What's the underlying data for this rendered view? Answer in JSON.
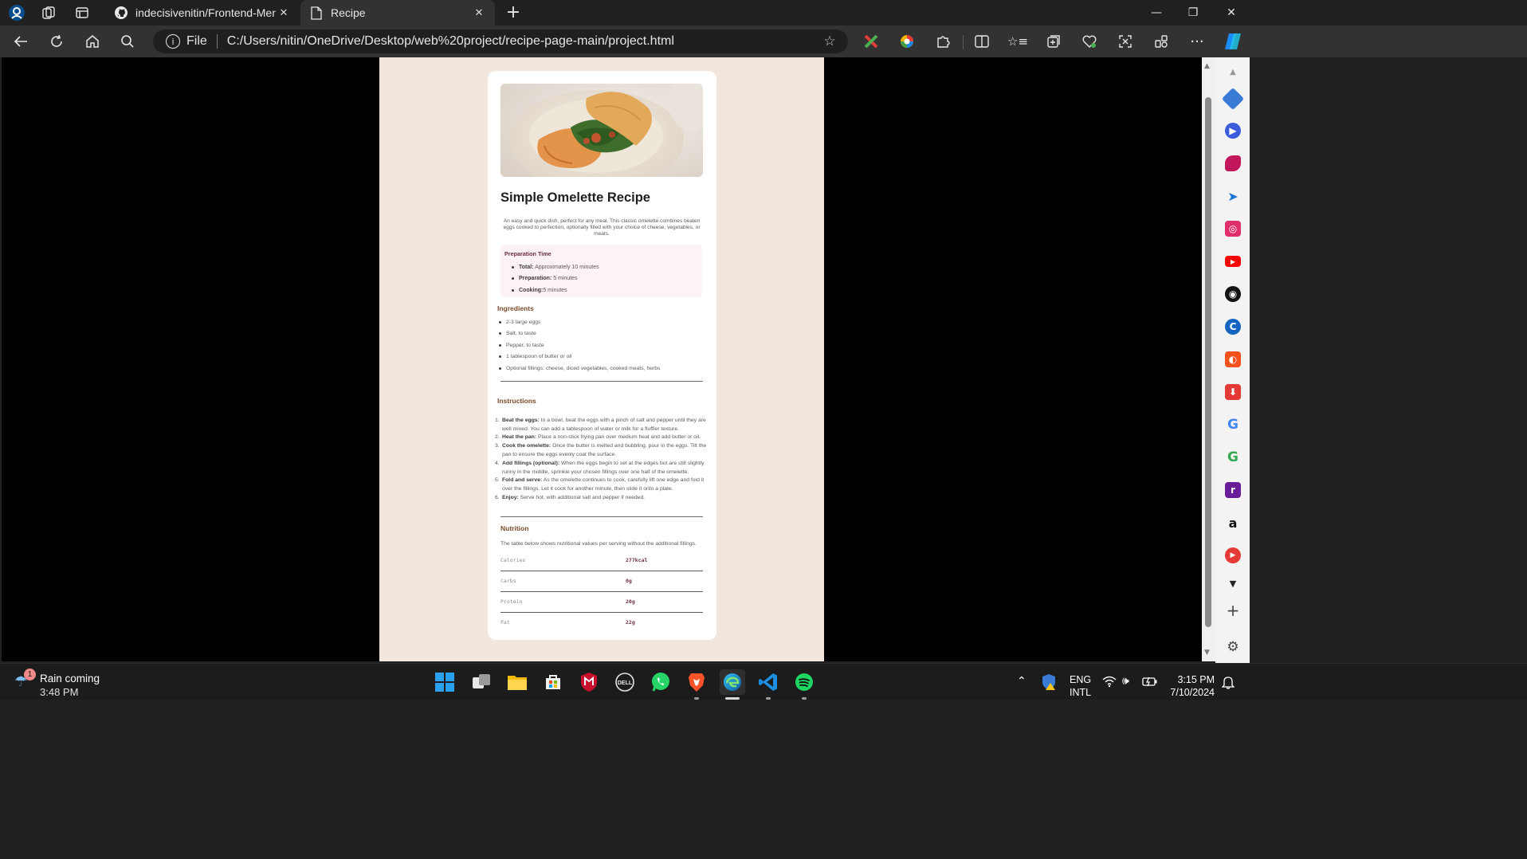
{
  "browser": {
    "tabs": [
      {
        "label": "indecisivenitin/Frontend-Mentor",
        "close": "✕"
      },
      {
        "label": "Recipe",
        "close": "✕"
      }
    ],
    "new_tab": "+",
    "window_controls": {
      "minimize": "—",
      "restore": "❐",
      "close": "✕"
    },
    "address": {
      "scheme_label": "File",
      "url": "C:/Users/nitin/OneDrive/Desktop/web%20project/recipe-page-main/project.html"
    }
  },
  "recipe": {
    "title": "Simple Omelette Recipe",
    "description": "An easy and quick dish, perfect for any meal. This classic omelette combines beaten eggs cooked to perfection, optionally filled with your choice of cheese, vegetables, or meats.",
    "preparation": {
      "title": "Preparation Time",
      "items": [
        {
          "label": "Total:",
          "value": "Approximately 10 minutes"
        },
        {
          "label": "Preparation:",
          "value": "5 minutes"
        },
        {
          "label": "Cooking:",
          "value": "5 minutes"
        }
      ]
    },
    "ingredients": {
      "title": "Ingredients",
      "items": [
        "2-3 large eggs",
        "Salt, to taste",
        "Pepper, to taste",
        "1 tablespoon of butter or oil",
        "Optional fillings: cheese, diced vegetables, cooked meats, herbs"
      ]
    },
    "instructions": {
      "title": "Instructions",
      "steps": [
        {
          "num": "1.",
          "label": "Beat the eggs:",
          "text": "In a bowl, beat the eggs with a pinch of salt and pepper until they are well mixed. You can add a tablespoon of water or milk for a fluffier texture."
        },
        {
          "num": "2.",
          "label": "Heat the pan:",
          "text": "Place a non-stick frying pan over medium heat and add butter or oil."
        },
        {
          "num": "3.",
          "label": "Cook the omelette:",
          "text": "Once the butter is melted and bubbling, pour in the eggs. Tilt the pan to ensure the eggs evenly coat the surface."
        },
        {
          "num": "4.",
          "label": "Add fillings (optional):",
          "text": "When the eggs begin to set at the edges but are still slightly runny in the middle, sprinkle your chosen fillings over one half of the omelette."
        },
        {
          "num": "5.",
          "label": "Fold and serve:",
          "text": "As the omelette continues to cook, carefully lift one edge and fold it over the fillings. Let it cook for another minute, then slide it onto a plate."
        },
        {
          "num": "6.",
          "label": "Enjoy:",
          "text": "Serve hot, with additional salt and pepper if needed."
        }
      ]
    },
    "nutrition": {
      "title": "Nutrition",
      "description": "The table below shows nutritional values per serving without the additional fillings.",
      "rows": [
        {
          "key": "Calories",
          "value": "277kcal"
        },
        {
          "key": "Carbs",
          "value": "0g"
        },
        {
          "key": "Protein",
          "value": "20g"
        },
        {
          "key": "Fat",
          "value": "22g"
        }
      ]
    }
  },
  "taskbar": {
    "weather": {
      "badge": "1",
      "line1": "Rain coming",
      "line2": "3:48 PM"
    },
    "language": {
      "line1": "ENG",
      "line2": "INTL"
    },
    "clock": {
      "time": "3:15 PM",
      "date": "7/10/2024"
    }
  },
  "colors": {
    "page_background": "#f3e6dd",
    "card": "#ffffff",
    "prep_box": "#fdf2f6",
    "heading_accent": "#7a4a2a",
    "nutrition_value": "#6e2d3c"
  }
}
